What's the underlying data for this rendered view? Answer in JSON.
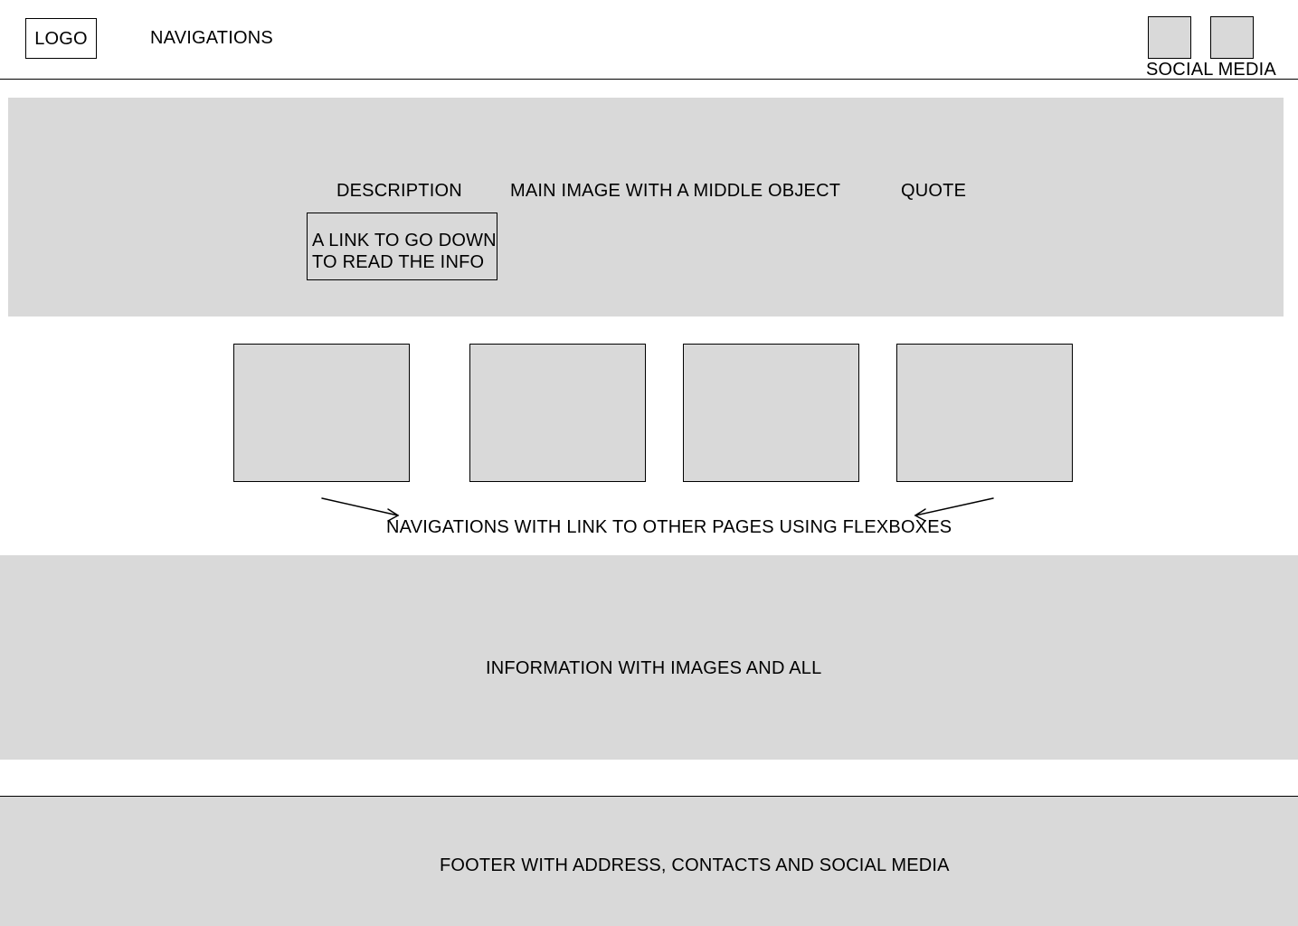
{
  "header": {
    "logo": "LOGO",
    "navigations": "NAVIGATIONS",
    "social_media": "SOCIAL MEDIA"
  },
  "hero": {
    "description": "DESCRIPTION",
    "main_image": "MAIN IMAGE WITH A MIDDLE OBJECT",
    "quote": "QUOTE",
    "link_line1": "A LINK TO GO DOWN",
    "link_line2": "TO READ THE INFO"
  },
  "cards": {
    "caption": "NAVIGATIONS WITH LINK TO OTHER PAGES USING FLEXBOXES"
  },
  "info": {
    "label": "INFORMATION WITH IMAGES AND ALL"
  },
  "footer": {
    "label": "FOOTER WITH ADDRESS, CONTACTS AND SOCIAL MEDIA"
  },
  "colors": {
    "placeholder_fill": "#d9d9d9",
    "stroke": "#000000",
    "background": "#ffffff"
  },
  "icons": {
    "social_icons": [
      "social-media-icon",
      "social-media-icon"
    ],
    "arrows": [
      "arrow-right-icon",
      "arrow-left-icon"
    ]
  }
}
